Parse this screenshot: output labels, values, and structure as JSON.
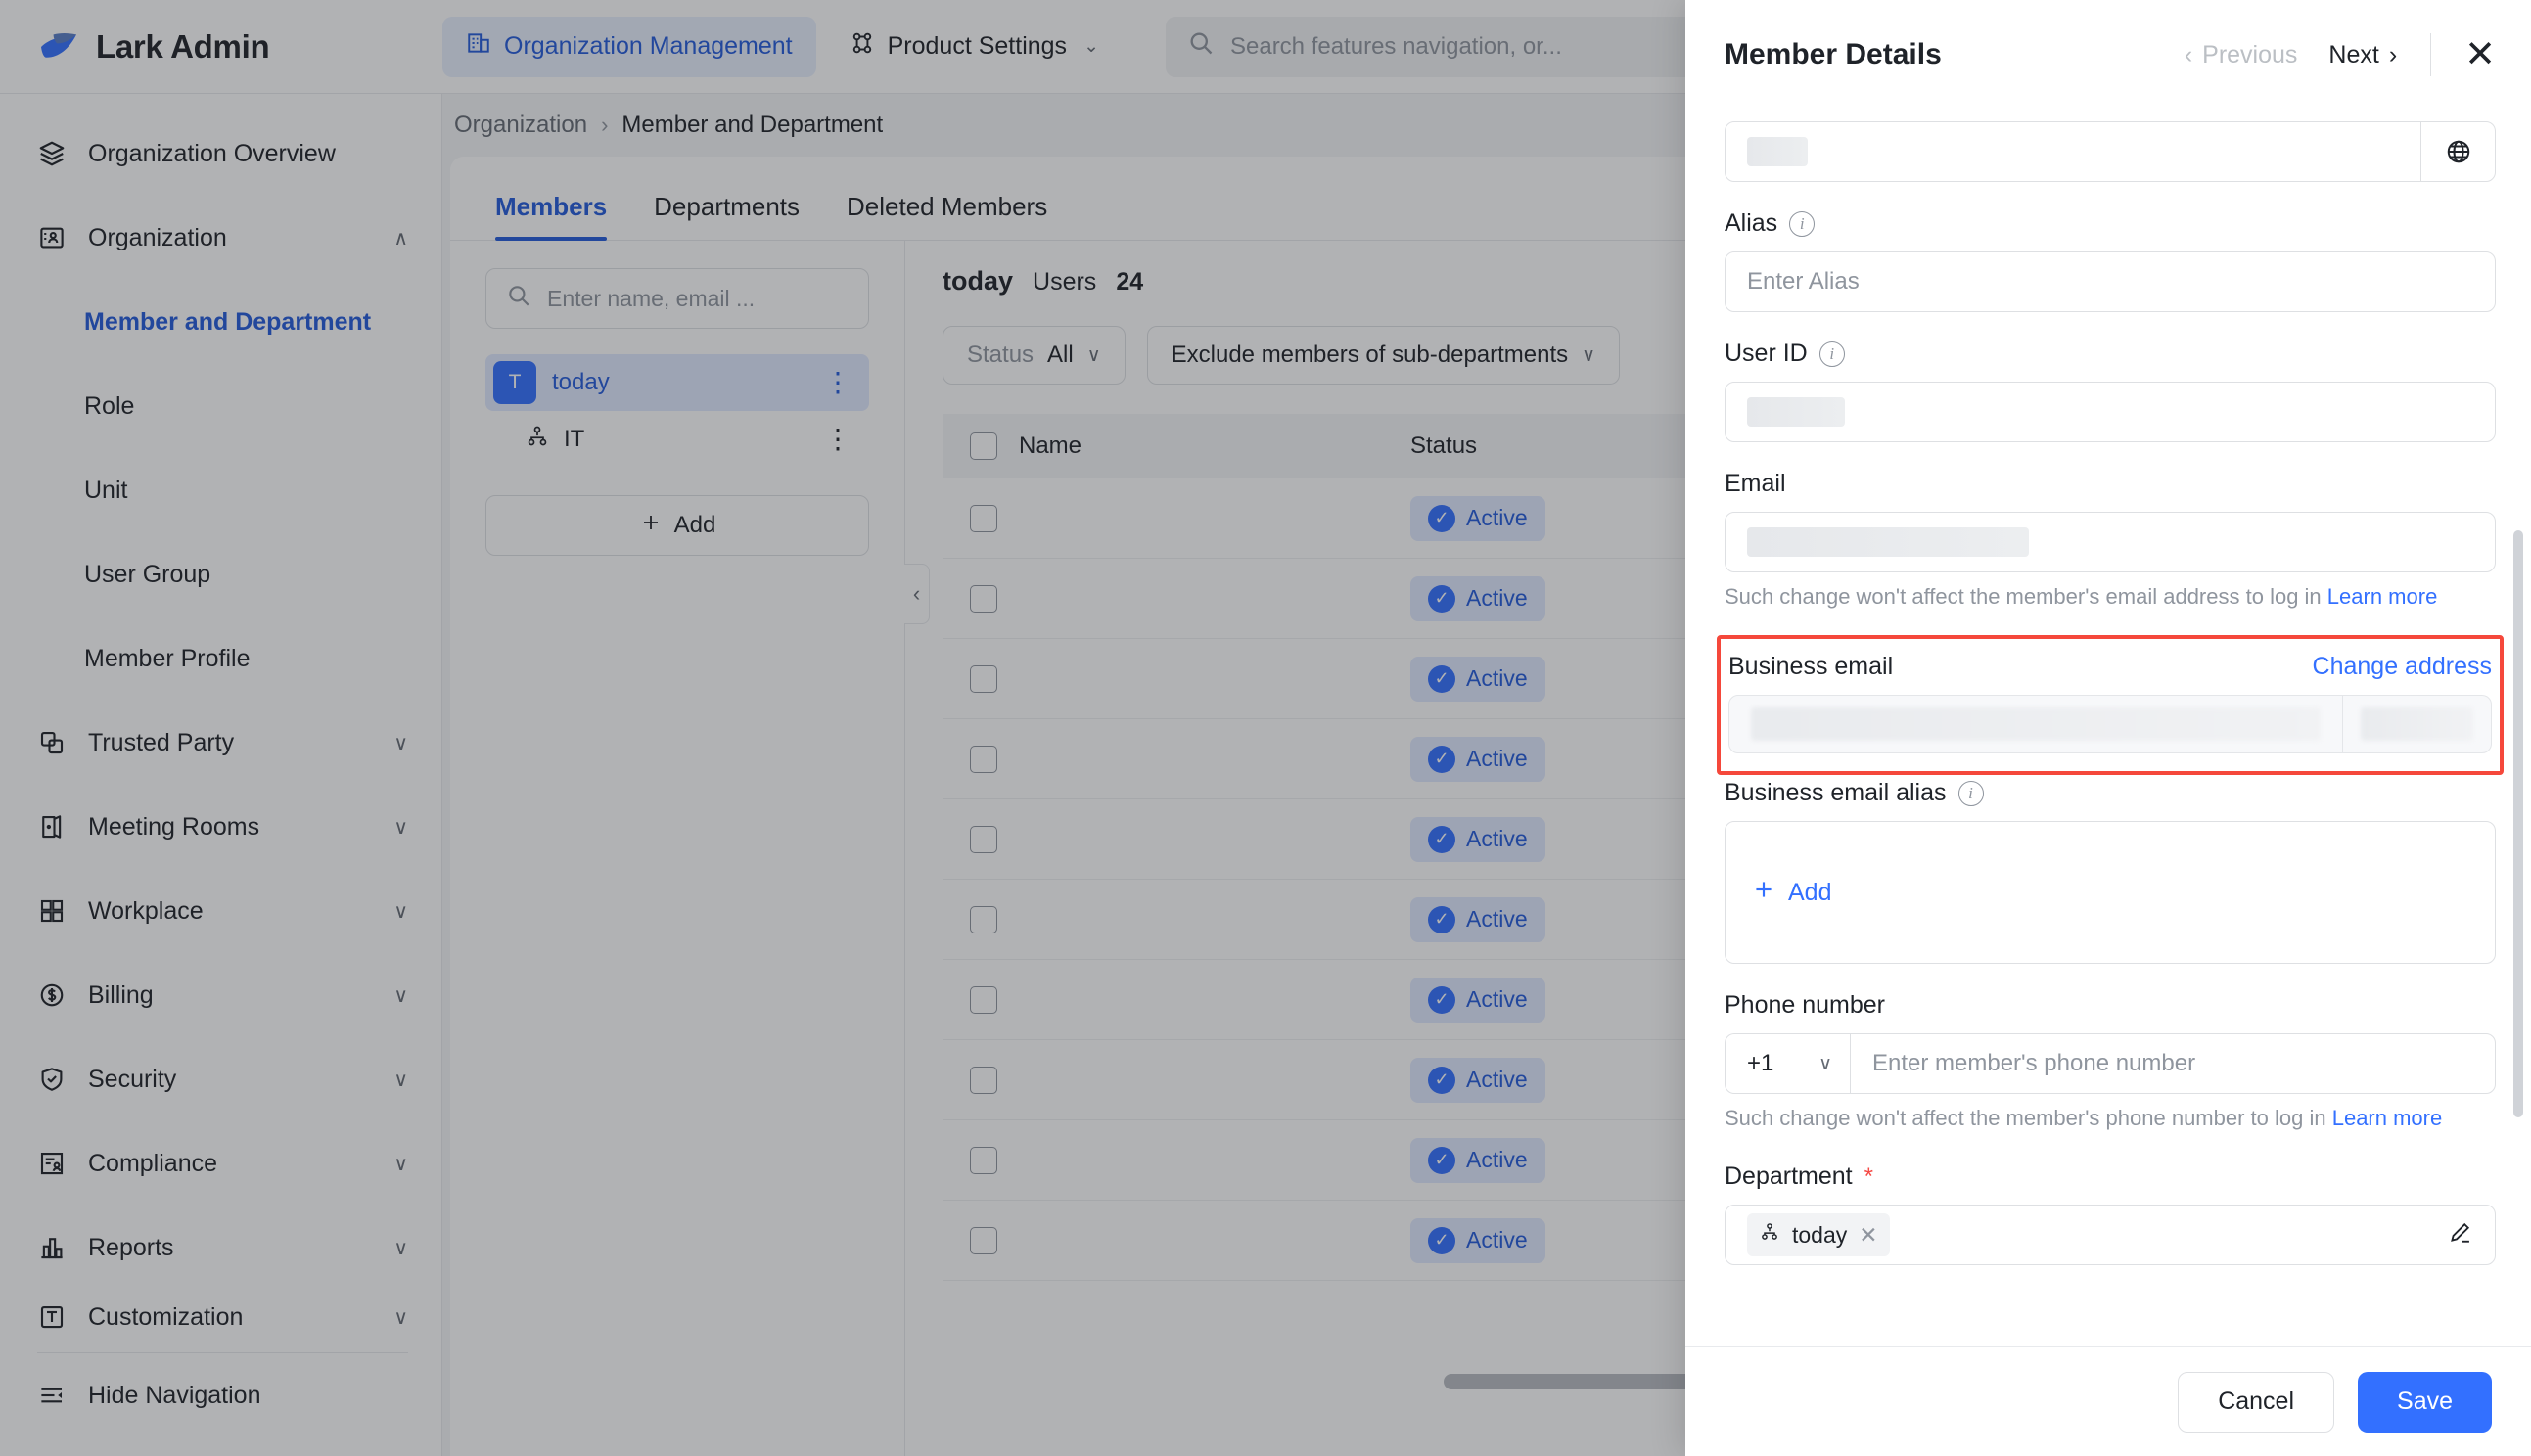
{
  "brand": {
    "title": "Lark Admin",
    "logo_icon": "lark-bird-logo"
  },
  "topnav": {
    "items": [
      {
        "label": "Organization Management",
        "icon": "building-icon",
        "active": true
      },
      {
        "label": "Product Settings",
        "icon": "puzzle-icon",
        "active": false,
        "chevron": "⌄"
      }
    ],
    "search": {
      "placeholder": "Search features navigation, or...",
      "icon": "search-icon"
    }
  },
  "sidebar": {
    "items": [
      {
        "label": "Organization Overview",
        "icon": "layers-icon",
        "type": "item"
      },
      {
        "label": "Organization",
        "icon": "contact-card-icon",
        "type": "group",
        "chevron": "∧",
        "expanded": true
      },
      {
        "label": "Member and Department",
        "type": "sub",
        "active": true
      },
      {
        "label": "Role",
        "type": "sub",
        "active": false
      },
      {
        "label": "Unit",
        "type": "sub",
        "active": false
      },
      {
        "label": "User Group",
        "type": "sub",
        "active": false
      },
      {
        "label": "Member Profile",
        "type": "sub",
        "active": false
      },
      {
        "label": "Trusted Party",
        "icon": "copy-icon",
        "type": "group",
        "chevron": "∨"
      },
      {
        "label": "Meeting Rooms",
        "icon": "door-icon",
        "type": "group",
        "chevron": "∨"
      },
      {
        "label": "Workplace",
        "icon": "grid-icon",
        "type": "group",
        "chevron": "∨"
      },
      {
        "label": "Billing",
        "icon": "dollar-circle-icon",
        "type": "group",
        "chevron": "∨"
      },
      {
        "label": "Security",
        "icon": "shield-check-icon",
        "type": "group",
        "chevron": "∨"
      },
      {
        "label": "Compliance",
        "icon": "compliance-icon",
        "type": "group",
        "chevron": "∨"
      },
      {
        "label": "Reports",
        "icon": "bar-chart-icon",
        "type": "group",
        "chevron": "∨"
      },
      {
        "label": "Customization",
        "icon": "customization-icon",
        "type": "group",
        "chevron": "∨"
      }
    ],
    "hide_navigation": {
      "label": "Hide Navigation",
      "icon": "collapse-nav-icon"
    }
  },
  "breadcrumb": {
    "parent": "Organization",
    "separator": "›",
    "current": "Member and Department"
  },
  "tabs": [
    {
      "label": "Members",
      "active": true
    },
    {
      "label": "Departments",
      "active": false
    },
    {
      "label": "Deleted Members",
      "active": false
    }
  ],
  "department_panel": {
    "search_placeholder": "Enter name, email ...",
    "search_icon": "search-icon",
    "collapse_icon": "chevron-left-icon",
    "nodes": [
      {
        "label": "today",
        "avatar_letter": "T",
        "selected": true,
        "menu_icon": "more-vertical-icon"
      },
      {
        "label": "IT",
        "icon": "org-tree-icon",
        "selected": false,
        "menu_icon": "more-vertical-icon"
      }
    ],
    "add_button": {
      "label": "Add",
      "icon": "plus-icon"
    }
  },
  "members": {
    "department": "today",
    "users_label": "Users",
    "users_count": "24",
    "filters": [
      {
        "key": "Status",
        "value": "All",
        "chevron": "∨"
      },
      {
        "key": "",
        "value": "Exclude members of sub-departments",
        "chevron": "∨"
      }
    ],
    "columns": [
      "Name",
      "Status"
    ],
    "rows": [
      {
        "name": "",
        "status": "Active"
      },
      {
        "name": "",
        "status": "Active"
      },
      {
        "name": "",
        "status": "Active"
      },
      {
        "name": "",
        "status": "Active"
      },
      {
        "name": "",
        "status": "Active"
      },
      {
        "name": "",
        "status": "Active"
      },
      {
        "name": "",
        "status": "Active"
      },
      {
        "name": "",
        "status": "Active"
      },
      {
        "name": "",
        "status": "Active"
      },
      {
        "name": "",
        "status": "Active"
      }
    ],
    "status_icon": "check-circle-icon"
  },
  "drawer": {
    "title": "Member Details",
    "previous": {
      "label": "Previous",
      "icon": "chevron-left-icon",
      "disabled": true
    },
    "next": {
      "label": "Next",
      "icon": "chevron-right-icon",
      "disabled": false
    },
    "close_icon": "close-icon",
    "fields": {
      "name": {
        "value": "",
        "suffix_icon": "globe-icon"
      },
      "alias": {
        "label": "Alias",
        "info_icon": "info-icon",
        "placeholder": "Enter Alias"
      },
      "user_id": {
        "label": "User ID",
        "info_icon": "info-icon",
        "value": ""
      },
      "email": {
        "label": "Email",
        "value": "",
        "hint": "Such change won't affect the member's email address to log in",
        "hint_link": "Learn more"
      },
      "business_email": {
        "label": "Business email",
        "action": "Change address",
        "value": "",
        "highlighted": true
      },
      "business_email_alias": {
        "label": "Business email alias",
        "info_icon": "info-icon",
        "add_label": "Add",
        "add_icon": "plus-icon"
      },
      "phone": {
        "label": "Phone number",
        "country_code": "+1",
        "chevron": "∨",
        "placeholder": "Enter member's phone number",
        "hint": "Such change won't affect the member's phone number to log in",
        "hint_link": "Learn more"
      },
      "department": {
        "label": "Department",
        "required_mark": "*",
        "chip": "today",
        "chip_icon": "org-tree-icon",
        "chip_remove_icon": "close-icon",
        "edit_icon": "pencil-icon"
      }
    },
    "footer": {
      "cancel": "Cancel",
      "save": "Save"
    }
  },
  "colors": {
    "accent": "#3370ff",
    "link": "#3370ff",
    "active_nav": "#245bdb",
    "badge_bg": "#e1eaff",
    "highlight_border": "#f5483b",
    "required": "#f54a45"
  }
}
